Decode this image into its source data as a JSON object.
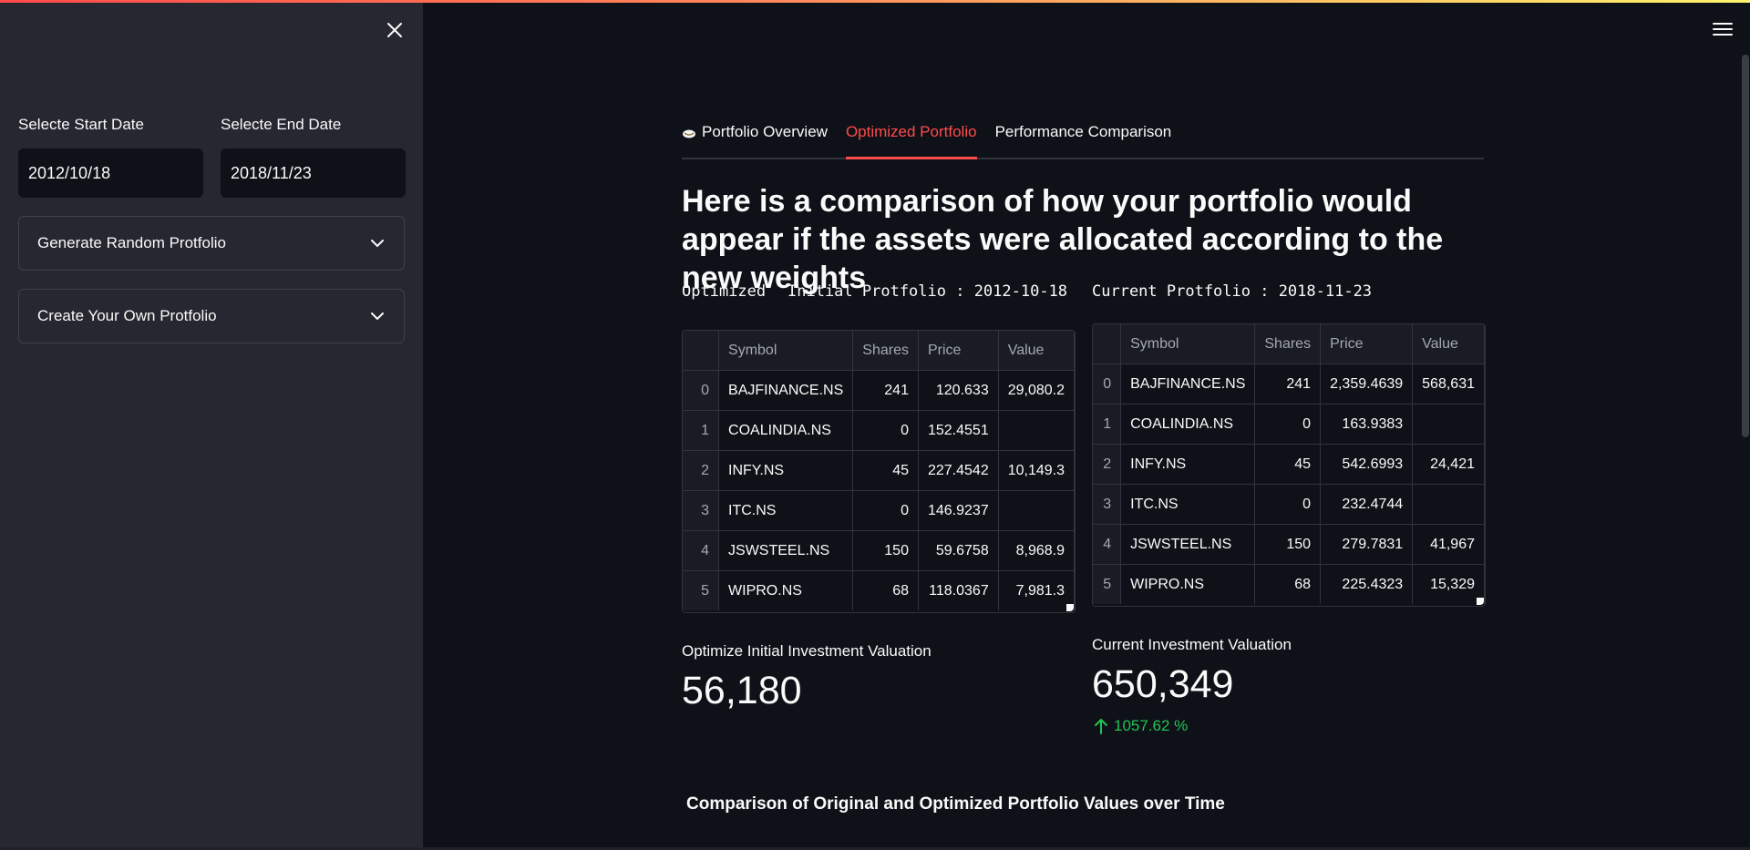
{
  "sidebar": {
    "start_date_label": "Selecte Start Date",
    "end_date_label": "Selecte End Date",
    "start_date_value": "2012/10/18",
    "end_date_value": "2018/11/23",
    "expanders": [
      "Generate Random Protfolio",
      "Create Your Own Protfolio"
    ]
  },
  "tabs": [
    {
      "label": "Portfolio Overview",
      "icon": "money-bag-icon",
      "active": false
    },
    {
      "label": "Optimized Portfolio",
      "active": true
    },
    {
      "label": "Performance Comparison",
      "active": false
    }
  ],
  "headline": "Here is a comparison of how your portfolio would appear if the assets were allocated according to the new weights",
  "captions": {
    "optimized": "Optimized",
    "initial": "Initial Protfolio : 2012-10-18",
    "current": "Current Protfolio : 2018-11-23"
  },
  "table_columns": [
    "",
    "Symbol",
    "Shares",
    "Price",
    "Value"
  ],
  "initial_table": [
    {
      "idx": "0",
      "symbol": "BAJFINANCE.NS",
      "shares": "241",
      "price": "120.633",
      "value": "29,080.2"
    },
    {
      "idx": "1",
      "symbol": "COALINDIA.NS",
      "shares": "0",
      "price": "152.4551",
      "value": ""
    },
    {
      "idx": "2",
      "symbol": "INFY.NS",
      "shares": "45",
      "price": "227.4542",
      "value": "10,149.3"
    },
    {
      "idx": "3",
      "symbol": "ITC.NS",
      "shares": "0",
      "price": "146.9237",
      "value": ""
    },
    {
      "idx": "4",
      "symbol": "JSWSTEEL.NS",
      "shares": "150",
      "price": "59.6758",
      "value": "8,968.9"
    },
    {
      "idx": "5",
      "symbol": "WIPRO.NS",
      "shares": "68",
      "price": "118.0367",
      "value": "7,981.3"
    }
  ],
  "current_table": [
    {
      "idx": "0",
      "symbol": "BAJFINANCE.NS",
      "shares": "241",
      "price": "2,359.4639",
      "value": "568,631"
    },
    {
      "idx": "1",
      "symbol": "COALINDIA.NS",
      "shares": "0",
      "price": "163.9383",
      "value": ""
    },
    {
      "idx": "2",
      "symbol": "INFY.NS",
      "shares": "45",
      "price": "542.6993",
      "value": "24,421"
    },
    {
      "idx": "3",
      "symbol": "ITC.NS",
      "shares": "0",
      "price": "232.4744",
      "value": ""
    },
    {
      "idx": "4",
      "symbol": "JSWSTEEL.NS",
      "shares": "150",
      "price": "279.7831",
      "value": "41,967"
    },
    {
      "idx": "5",
      "symbol": "WIPRO.NS",
      "shares": "68",
      "price": "225.4323",
      "value": "15,329"
    }
  ],
  "metrics": {
    "initial_label": "Optimize Initial Investment Valuation",
    "initial_value": "56,180",
    "current_label": "Current Investment Valuation",
    "current_value": "650,349",
    "current_delta": "1057.62 %"
  },
  "section_title": "Comparison of Original and Optimized Portfolio Values over Time",
  "colors": {
    "accent": "#ff4b4b",
    "background": "#0e1117",
    "sidebar": "#262730",
    "delta_positive": "#21c354"
  }
}
